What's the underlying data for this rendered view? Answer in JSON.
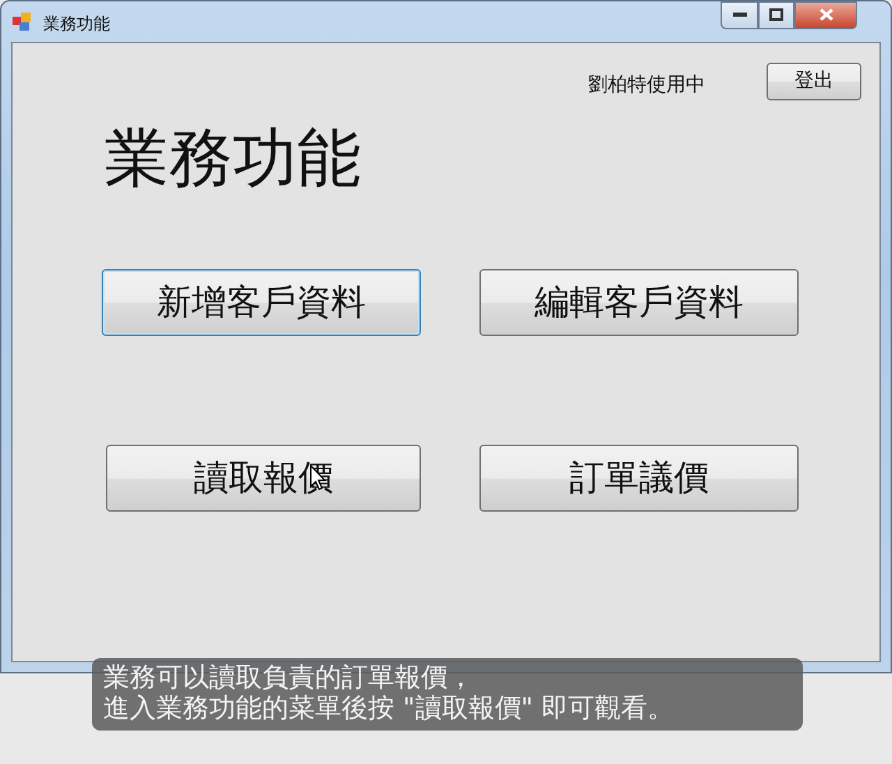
{
  "window": {
    "title": "業務功能"
  },
  "user_label": "劉柏特使用中",
  "logout_button": "登出",
  "heading": "業務功能",
  "buttons": [
    {
      "label": "新增客戶資料",
      "focused": true
    },
    {
      "label": "編輯客戶資料",
      "focused": false
    },
    {
      "label": "讀取報價",
      "focused": false
    },
    {
      "label": "訂單議價",
      "focused": false
    }
  ],
  "caption": [
    "業務可以讀取負責的訂單報價，",
    "進入業務功能的菜單後按 \"讀取報價\" 即可觀看。"
  ]
}
